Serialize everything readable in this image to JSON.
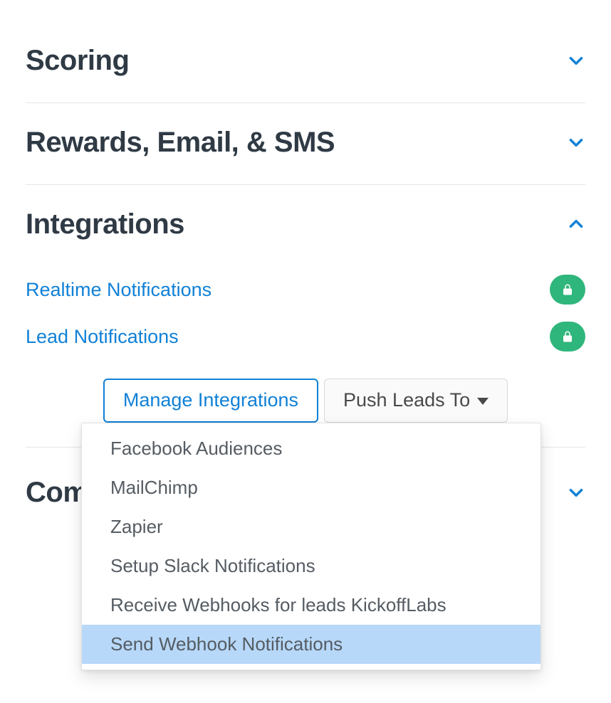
{
  "sections": {
    "scoring": {
      "title": "Scoring"
    },
    "rewards": {
      "title": "Rewards, Email, & SMS"
    },
    "integrations": {
      "title": "Integrations",
      "links": {
        "realtime": "Realtime Notifications",
        "lead": "Lead Notifications"
      },
      "buttons": {
        "manage": "Manage Integrations",
        "push": "Push Leads To"
      },
      "dropdown": [
        "Facebook Audiences",
        "MailChimp",
        "Zapier",
        "Setup Slack Notifications",
        "Receive Webhooks for leads KickoffLabs",
        "Send Webhook Notifications"
      ],
      "dropdown_highlight_index": 5
    },
    "compliance": {
      "title": "Com"
    }
  }
}
